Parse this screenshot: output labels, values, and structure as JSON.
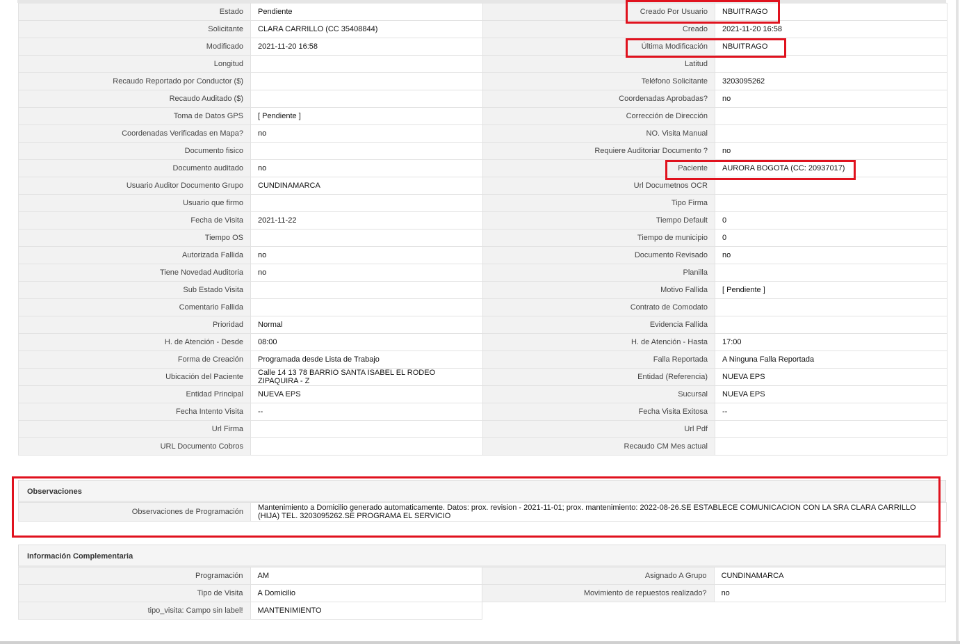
{
  "main_rows": [
    {
      "l1": "Estado",
      "v1": "Pendiente",
      "l2": "Creado Por Usuario",
      "v2": "NBUITRAGO"
    },
    {
      "l1": "Solicitante",
      "v1": "CLARA CARRILLO (CC 35408844)",
      "l2": "Creado",
      "v2": "2021-11-20 16:58"
    },
    {
      "l1": "Modificado",
      "v1": "2021-11-20 16:58",
      "l2": "Última Modificación",
      "v2": " NBUITRAGO"
    },
    {
      "l1": "Longitud",
      "v1": "",
      "l2": "Latitud",
      "v2": ""
    },
    {
      "l1": "Recaudo Reportado por Conductor ($)",
      "v1": "",
      "l2": "Teléfono Solicitante",
      "v2": "3203095262"
    },
    {
      "l1": "Recaudo Auditado ($)",
      "v1": "",
      "l2": "Coordenadas Aprobadas?",
      "v2": " no"
    },
    {
      "l1": "Toma de Datos GPS",
      "v1": "[ Pendiente ]",
      "l2": "Corrección de Dirección",
      "v2": ""
    },
    {
      "l1": "Coordenadas Verificadas en Mapa?",
      "v1": " no",
      "l2": "NO. Visita Manual",
      "v2": ""
    },
    {
      "l1": "Documento fisico",
      "v1": "",
      "l2": "Requiere Auditoriar Documento ?",
      "v2": " no"
    },
    {
      "l1": "Documento auditado",
      "v1": " no",
      "l2": "Paciente",
      "v2": "AURORA BOGOTA (CC: 20937017)"
    },
    {
      "l1": "Usuario Auditor Documento Grupo",
      "v1": "CUNDINAMARCA",
      "l2": "Url Documetnos OCR",
      "v2": ""
    },
    {
      "l1": "Usuario que firmo",
      "v1": "",
      "l2": "Tipo Firma",
      "v2": ""
    },
    {
      "l1": "Fecha de Visita",
      "v1": " 2021-11-22",
      "l2": "Tiempo Default",
      "v2": "0"
    },
    {
      "l1": "Tiempo OS",
      "v1": "",
      "l2": "Tiempo de municipio",
      "v2": "0"
    },
    {
      "l1": "Autorizada Fallida",
      "v1": " no",
      "l2": "Documento Revisado",
      "v2": " no"
    },
    {
      "l1": "Tiene Novedad Auditoria",
      "v1": " no",
      "l2": "Planilla",
      "v2": ""
    },
    {
      "l1": "Sub Estado Visita",
      "v1": "",
      "l2": "Motivo Fallida",
      "v2": "[ Pendiente ]"
    },
    {
      "l1": "Comentario Fallida",
      "v1": "",
      "l2": "Contrato de Comodato",
      "v2": ""
    },
    {
      "l1": "Prioridad",
      "v1": "Normal",
      "l2": "Evidencia Fallida",
      "v2": ""
    },
    {
      "l1": "H. de Atención - Desde",
      "v1": "08:00",
      "l2": "H. de Atención - Hasta",
      "v2": "17:00"
    },
    {
      "l1": "Forma de Creación",
      "v1": "Programada desde Lista de Trabajo",
      "l2": "Falla Reportada",
      "v2": "A Ninguna Falla Reportada"
    },
    {
      "l1": "Ubicación del Paciente",
      "v1": "Calle 14 13 78 BARRIO SANTA ISABEL EL RODEO ZIPAQUIRA - Z",
      "l2": "Entidad (Referencia)",
      "v2": "NUEVA EPS"
    },
    {
      "l1": "Entidad Principal",
      "v1": "NUEVA EPS",
      "l2": "Sucursal",
      "v2": "NUEVA EPS"
    },
    {
      "l1": "Fecha Intento Visita",
      "v1": " --",
      "l2": "Fecha Visita Exitosa",
      "v2": " --"
    },
    {
      "l1": "Url Firma",
      "v1": "",
      "l2": "Url Pdf",
      "v2": ""
    },
    {
      "l1": "URL Documento Cobros",
      "v1": "",
      "l2": "Recaudo CM Mes actual",
      "v2": ""
    }
  ],
  "observaciones": {
    "title": "Observaciones",
    "label": "Observaciones de Programación",
    "value": "  Mantenimiento a Domicilio generado automaticamente. Datos: prox. revision - 2021-11-01; prox. mantenimiento: 2022-08-26.SE ESTABLECE COMUNICACION CON LA SRA CLARA CARRILLO (HIJA) TEL. 3203095262.SE PROGRAMA EL SERVICIO"
  },
  "info_complementaria": {
    "title": "Información Complementaria",
    "rows": [
      {
        "l1": "Programación",
        "v1": "AM",
        "l2": "Asignado A Grupo",
        "v2": "CUNDINAMARCA"
      },
      {
        "l1": "Tipo de Visita",
        "v1": "A Domicilio",
        "l2": "Movimiento de repuestos realizado?",
        "v2": " no"
      },
      {
        "l1": "tipo_visita: Campo sin label!",
        "v1": "MANTENIMIENTO",
        "l2": "",
        "v2": ""
      }
    ]
  },
  "colors": {
    "highlight": "#e0121e",
    "label_bg": "#f2f2f2",
    "value_bg": "#ffffff"
  }
}
